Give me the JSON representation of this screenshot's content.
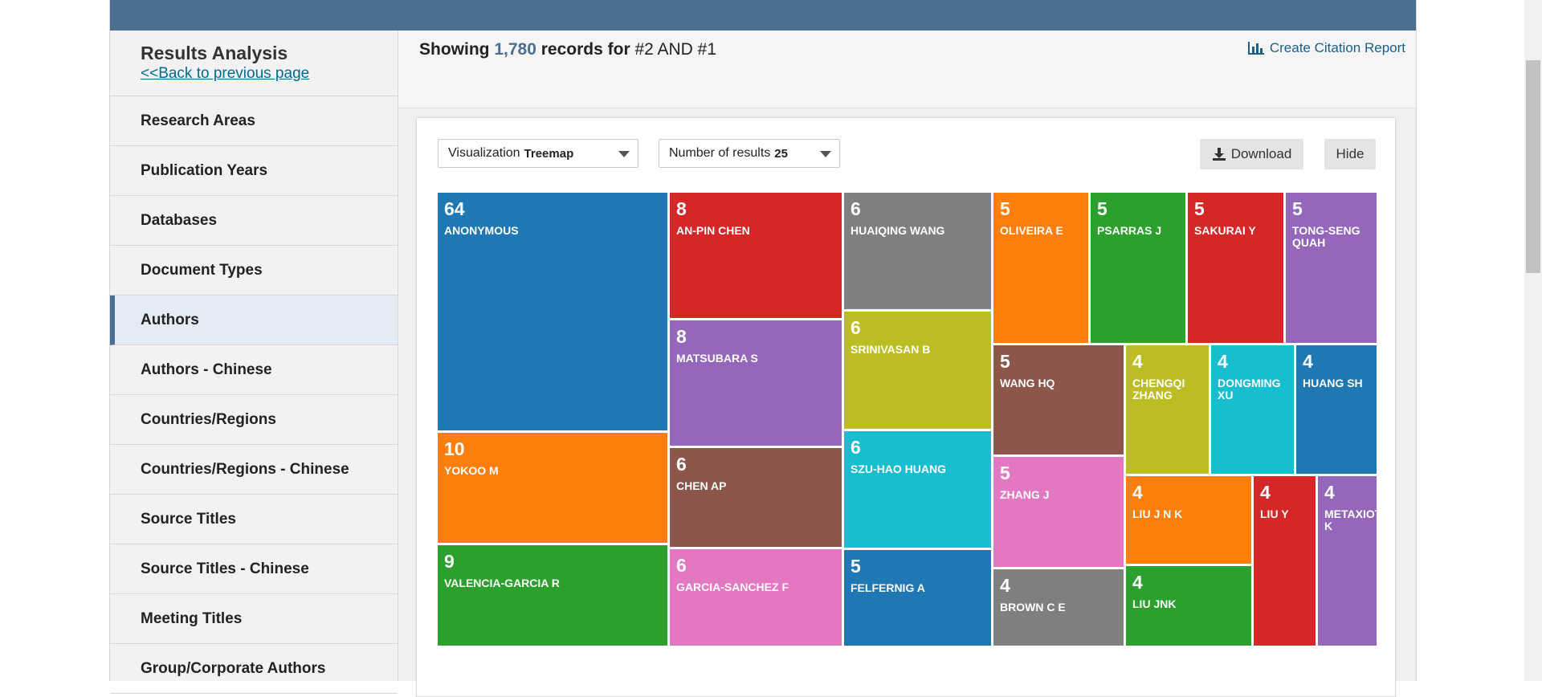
{
  "sidebar": {
    "title": "Results Analysis",
    "back_link": "<<Back to previous page",
    "items": [
      {
        "label": "Research Areas"
      },
      {
        "label": "Publication Years"
      },
      {
        "label": "Databases"
      },
      {
        "label": "Document Types"
      },
      {
        "label": "Authors"
      },
      {
        "label": "Authors - Chinese"
      },
      {
        "label": "Countries/Regions"
      },
      {
        "label": "Countries/Regions - Chinese"
      },
      {
        "label": "Source Titles"
      },
      {
        "label": "Source Titles - Chinese"
      },
      {
        "label": "Meeting Titles"
      },
      {
        "label": "Group/Corporate Authors"
      }
    ],
    "active_item": "Authors"
  },
  "header": {
    "showing_prefix": "Showing",
    "record_count": "1,780",
    "records_for": "records for",
    "query": "#2 AND #1",
    "citation_report": "Create Citation Report"
  },
  "controls": {
    "visualization_label": "Visualization",
    "visualization_value": "Treemap",
    "results_label": "Number of results",
    "results_value": "25",
    "download": "Download",
    "hide": "Hide"
  },
  "colors": {
    "blue": "#1f77b4",
    "red": "#d62728",
    "gray": "#7f7f7f",
    "orange": "#ff7f0e",
    "green": "#2ca02c",
    "purple": "#9467bd",
    "olive": "#bcbd22",
    "cyan": "#17becf",
    "brown": "#8c564b",
    "pink": "#e377c2",
    "header_bar": "#4b6f93"
  },
  "chart_data": {
    "type": "treemap",
    "items": [
      {
        "name": "ANONYMOUS",
        "value": 64,
        "color": "blue"
      },
      {
        "name": "YOKOO M",
        "value": 10,
        "color": "orange"
      },
      {
        "name": "VALENCIA-GARCIA R",
        "value": 9,
        "color": "green"
      },
      {
        "name": "AN-PIN CHEN",
        "value": 8,
        "color": "red"
      },
      {
        "name": "MATSUBARA S",
        "value": 8,
        "color": "purple"
      },
      {
        "name": "CHEN AP",
        "value": 6,
        "color": "brown"
      },
      {
        "name": "GARCIA-SANCHEZ F",
        "value": 6,
        "color": "pink"
      },
      {
        "name": "HUAIQING WANG",
        "value": 6,
        "color": "gray"
      },
      {
        "name": "SRINIVASAN B",
        "value": 6,
        "color": "olive"
      },
      {
        "name": "SZU-HAO HUANG",
        "value": 6,
        "color": "cyan"
      },
      {
        "name": "FELFERNIG A",
        "value": 5,
        "color": "blue"
      },
      {
        "name": "OLIVEIRA E",
        "value": 5,
        "color": "orange"
      },
      {
        "name": "PSARRAS J",
        "value": 5,
        "color": "green"
      },
      {
        "name": "SAKURAI Y",
        "value": 5,
        "color": "red"
      },
      {
        "name": "TONG-SENG QUAH",
        "value": 5,
        "color": "purple"
      },
      {
        "name": "WANG HQ",
        "value": 5,
        "color": "brown"
      },
      {
        "name": "ZHANG J",
        "value": 5,
        "color": "pink"
      },
      {
        "name": "BROWN C E",
        "value": 4,
        "color": "gray"
      },
      {
        "name": "CHENGQI ZHANG",
        "value": 4,
        "color": "olive"
      },
      {
        "name": "DONGMING XU",
        "value": 4,
        "color": "cyan"
      },
      {
        "name": "HUANG SH",
        "value": 4,
        "color": "blue"
      },
      {
        "name": "LIU J N K",
        "value": 4,
        "color": "orange"
      },
      {
        "name": "LIU JNK",
        "value": 4,
        "color": "green"
      },
      {
        "name": "LIU Y",
        "value": 4,
        "color": "red"
      },
      {
        "name": "METAXIOTIS K",
        "value": 4,
        "color": "purple"
      }
    ]
  }
}
